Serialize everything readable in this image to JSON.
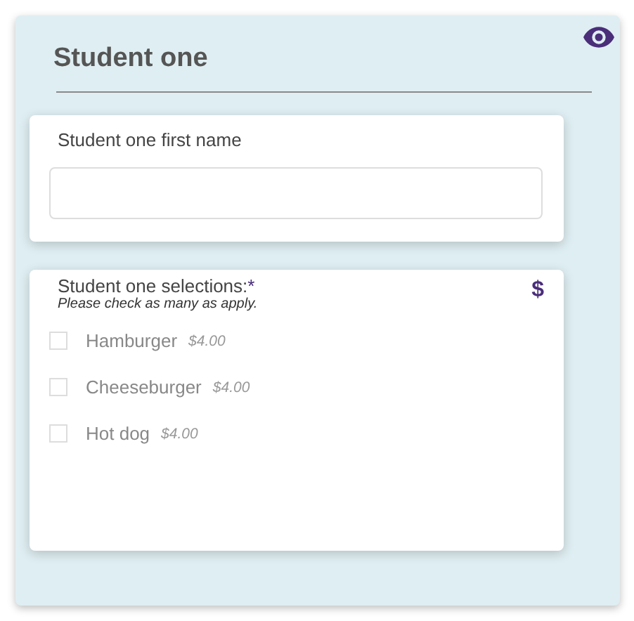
{
  "section": {
    "title": "Student one"
  },
  "name_field": {
    "label": "Student one first name"
  },
  "selections": {
    "label": "Student one selections:",
    "required_mark": "*",
    "hint": "Please check as many as apply.",
    "currency_symbol": "$",
    "options": [
      {
        "label": "Hamburger",
        "price": "$4.00",
        "checked": false
      },
      {
        "label": "Cheeseburger",
        "price": "$4.00",
        "checked": false
      },
      {
        "label": "Hot dog",
        "price": "$4.00",
        "checked": false
      }
    ]
  }
}
